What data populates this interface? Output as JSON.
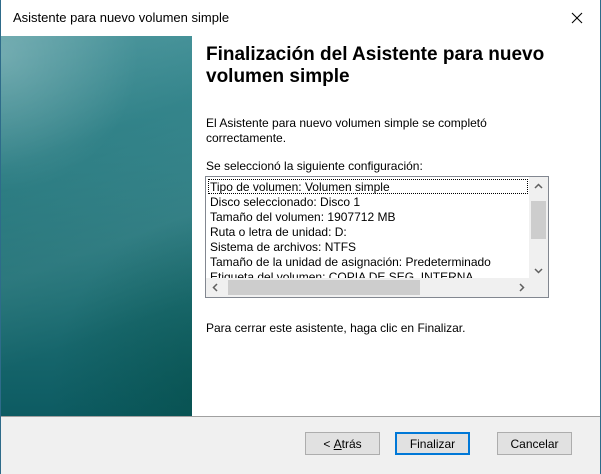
{
  "window": {
    "title": "Asistente para nuevo volumen simple",
    "close_icon": "close-icon"
  },
  "content": {
    "heading": "Finalización del Asistente para nuevo volumen simple",
    "completed_text": "El Asistente para nuevo volumen simple se completó correctamente.",
    "config_label": "Se seleccionó la siguiente configuración:",
    "config_lines": [
      "Tipo de volumen: Volumen simple",
      "Disco seleccionado: Disco 1",
      "Tamaño del volumen: 1907712 MB",
      "Ruta o letra de unidad: D:",
      "Sistema de archivos: NTFS",
      "Tamaño de la unidad de asignación: Predeterminado",
      "Etiqueta del volumen: COPIA DE SEG. INTERNA"
    ],
    "close_hint": "Para cerrar este asistente, haga clic en Finalizar."
  },
  "buttons": {
    "back_prefix": "< ",
    "back_accel": "A",
    "back_rest": "trás",
    "finish": "Finalizar",
    "cancel": "Cancelar"
  },
  "colors": {
    "accent": "#0078d7",
    "side_panel": "#2d7e84"
  }
}
